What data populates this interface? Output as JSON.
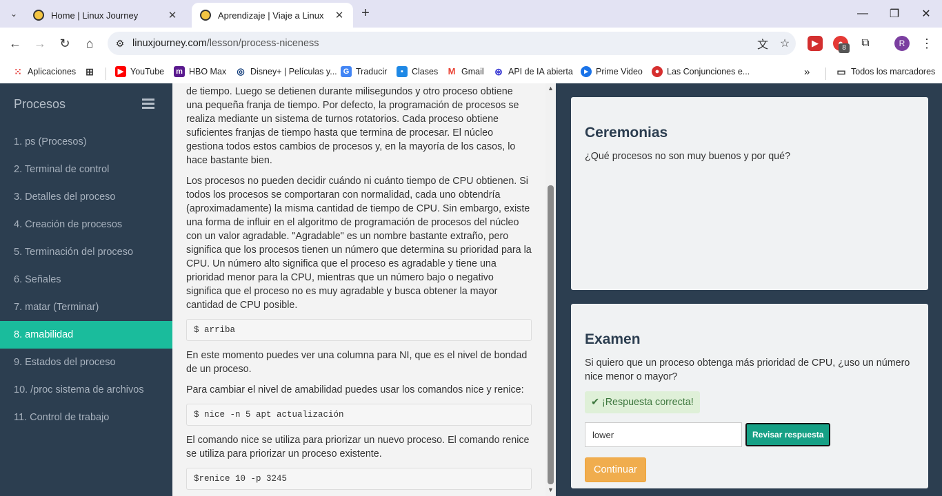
{
  "browser": {
    "tabs": [
      {
        "title": "Home | Linux Journey",
        "active": false
      },
      {
        "title": "Aprendizaje | Viaje a Linux",
        "active": true
      }
    ],
    "url_host": "linuxjourney.com",
    "url_path": "/lesson/process-niceness",
    "extension_badge": "8",
    "profile_initial": "R",
    "bookmarks": [
      {
        "label": "Aplicaciones",
        "icon": "apps-grid-icon"
      },
      {
        "label": "",
        "icon": "grid-icon"
      },
      {
        "label": "YouTube",
        "icon": "youtube-icon",
        "color": "#ff0000"
      },
      {
        "label": "HBO Max",
        "icon": "hbo-max-icon",
        "color": "#5a1a8e"
      },
      {
        "label": "Disney+ | Películas y...",
        "icon": "disney-icon",
        "color": "#113c7a"
      },
      {
        "label": "Traducir",
        "icon": "translate-icon",
        "color": "#4285f4"
      },
      {
        "label": "Clases",
        "icon": "classroom-icon",
        "color": "#1e88e5"
      },
      {
        "label": "Gmail",
        "icon": "gmail-icon",
        "color": "#ea4335"
      },
      {
        "label": "API de IA abierta",
        "icon": "openai-icon",
        "color": "#3b3bd4"
      },
      {
        "label": "Prime Video",
        "icon": "prime-video-icon",
        "color": "#1a73e8"
      },
      {
        "label": "Las Conjunciones e...",
        "icon": "conjunciones-icon",
        "color": "#d62f2f"
      }
    ],
    "all_bookmarks": "Todos los marcadores"
  },
  "sidebar": {
    "title": "Procesos",
    "items": [
      {
        "label": "1. ps (Procesos)"
      },
      {
        "label": "2. Terminal de control"
      },
      {
        "label": "3. Detalles del proceso"
      },
      {
        "label": "4. Creación de procesos"
      },
      {
        "label": "5. Terminación del proceso"
      },
      {
        "label": "6. Señales"
      },
      {
        "label": "7. matar (Terminar)"
      },
      {
        "label": "8. amabilidad",
        "active": true
      },
      {
        "label": "9. Estados del proceso"
      },
      {
        "label": "10. /proc sistema de archivos"
      },
      {
        "label": "11. Control de trabajo"
      }
    ]
  },
  "lesson": {
    "p1": "de tiempo. Luego se detienen durante milisegundos y otro proceso obtiene una pequeña franja de tiempo. Por defecto, la programación de procesos se realiza mediante un sistema de turnos rotatorios. Cada proceso obtiene suficientes franjas de tiempo hasta que termina de procesar. El núcleo gestiona todos estos cambios de procesos y, en la mayoría de los casos, lo hace bastante bien.",
    "p2": "Los procesos no pueden decidir cuándo ni cuánto tiempo de CPU obtienen. Si todos los procesos se comportaran con normalidad, cada uno obtendría (aproximadamente) la misma cantidad de tiempo de CPU. Sin embargo, existe una forma de influir en el algoritmo de programación de procesos del núcleo con un valor agradable. \"Agradable\" es un nombre bastante extraño, pero significa que los procesos tienen un número que determina su prioridad para la CPU. Un número alto significa que el proceso es agradable y tiene una prioridad menor para la CPU, mientras que un número bajo o negativo significa que el proceso no es muy agradable y busca obtener la mayor cantidad de CPU posible.",
    "code1": "$ arriba",
    "p3": "En este momento puedes ver una columna para NI, que es el nivel de bondad de un proceso.",
    "p4": "Para cambiar el nivel de amabilidad puedes usar los comandos nice y renice:",
    "code2": "$ nice -n 5 apt actualización",
    "p5": "El comando nice se utiliza para priorizar un nuevo proceso. El comando renice se utiliza para priorizar un proceso existente.",
    "code3": "$renice 10 -p 3245"
  },
  "ceremonias": {
    "title": "Ceremonias",
    "question": "¿Qué procesos no son muy buenos y por qué?"
  },
  "examen": {
    "title": "Examen",
    "question": "Si quiero que un proceso obtenga más prioridad de CPU, ¿uso un número nice menor o mayor?",
    "feedback": "¡Respuesta correcta!",
    "answer_value": "lower",
    "check_label": "Revisar respuesta",
    "continue_label": "Continuar"
  }
}
